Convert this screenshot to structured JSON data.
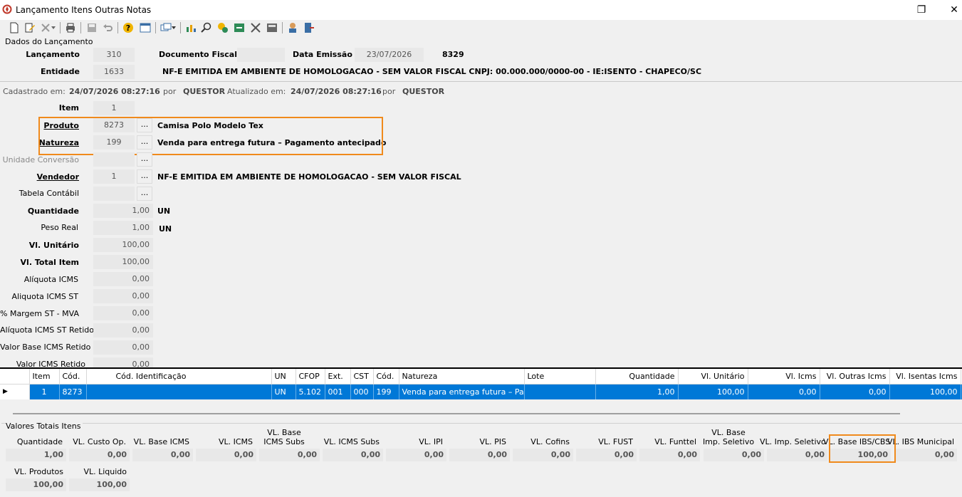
{
  "window": {
    "title": "Lançamento Itens Outras Notas",
    "restore_symbol": "❐",
    "close_symbol": "✕"
  },
  "group_title": "Dados do Lançamento",
  "header": {
    "lancamento_label": "Lançamento",
    "lancamento_value": "310",
    "documento_label": "Documento Fiscal",
    "documento_value": "",
    "data_emissao_label": "Data Emissão",
    "data_emissao_value": "23/07/2026",
    "number_value": "8329",
    "entidade_label": "Entidade",
    "entidade_value": "1633",
    "entidade_desc": "NF-E EMITIDA EM AMBIENTE DE HOMOLOGACAO - SEM VALOR FISCAL CNPJ: 00.000.000/0000-00 - IE:ISENTO - CHAPECO/SC"
  },
  "audit": {
    "cadastrado_label": "Cadastrado em:",
    "cadastrado_value": "24/07/2026 08:27:16",
    "por1": "por",
    "user1": "QUESTOR",
    "atualizado_label": "Atualizado em:",
    "atualizado_value": "24/07/2026 08:27:16",
    "por2": "por",
    "user2": "QUESTOR"
  },
  "form": {
    "item_label": "Item",
    "item_value": "1",
    "produto_label": "Produto",
    "produto_value": "8273",
    "produto_desc": "Camisa Polo Modelo Tex",
    "natureza_label": "Natureza",
    "natureza_value": "199",
    "natureza_desc": "Venda para entrega futura – Pagamento antecipado",
    "unidade_label": "Unidade Conversão",
    "vendedor_label": "Vendedor",
    "vendedor_value": "1",
    "vendedor_desc": "NF-E EMITIDA EM AMBIENTE DE HOMOLOGACAO - SEM VALOR FISCAL",
    "tabela_label": "Tabela Contábil",
    "dots": "...",
    "quantidade_label": "Quantidade",
    "quantidade_value": "1,00",
    "quantidade_unit": "UN",
    "peso_label": "Peso Real",
    "peso_value": "1,00",
    "peso_unit": "UN",
    "vl_unitario_label": "Vl. Unitário",
    "vl_unitario_value": "100,00",
    "vl_total_label": "Vl. Total Item",
    "vl_total_value": "100,00",
    "aliq_icms_label": "Alíquota ICMS",
    "aliq_icms_value": "0,00",
    "aliq_icms_st_label": "Aliquota ICMS ST",
    "aliq_icms_st_value": "0,00",
    "margem_label": "% Margem ST - MVA",
    "margem_value": "0,00",
    "aliq_st_retido_label": "Alíquota ICMS ST Retido",
    "aliq_st_retido_value": "0,00",
    "vl_base_retido_label": "Valor Base ICMS Retido",
    "vl_base_retido_value": "0,00",
    "vl_icms_retido_label": "Valor ICMS Retido",
    "vl_icms_retido_value": "0,00"
  },
  "grid": {
    "columns": [
      "Item",
      "Cód.",
      "Cód. Identificação",
      "Produto",
      "UN",
      "CFOP",
      "Ext.",
      "CST",
      "Cód.",
      "Natureza",
      "Lote",
      "Quantidade",
      "Vl. Unitário",
      "Vl. Icms",
      "Vl. Outras Icms",
      "Vl. Isentas Icms",
      "V"
    ],
    "row": [
      "1",
      "8273",
      "",
      "Camisa Polo Modelo Tex",
      "UN",
      "5.102",
      "001",
      "000",
      "199",
      "Venda para entrega futura – Pa...",
      "",
      "1,00",
      "100,00",
      "0,00",
      "0,00",
      "100,00",
      ""
    ],
    "row_indicator": "▶"
  },
  "totals": {
    "title": "Valores Totais Itens",
    "items": [
      {
        "label": "Quantidade",
        "value": "1,00"
      },
      {
        "label": "VL. Custo Op.",
        "value": "0,00"
      },
      {
        "label": "VL. Base ICMS",
        "value": "0,00"
      },
      {
        "label": "VL. ICMS",
        "value": "0,00"
      },
      {
        "label": "VL. Base\nICMS Subs",
        "value": "0,00"
      },
      {
        "label": "VL. ICMS Subs",
        "value": "0,00"
      },
      {
        "label": "VL. IPI",
        "value": "0,00"
      },
      {
        "label": "VL. PIS",
        "value": "0,00"
      },
      {
        "label": "VL. Cofins",
        "value": "0,00"
      },
      {
        "label": "VL. FUST",
        "value": "0,00"
      },
      {
        "label": "VL. Funttel",
        "value": "0,00"
      },
      {
        "label": "VL. Base\nImp. Seletivo",
        "value": "0,00"
      },
      {
        "label": "VL. Imp. Seletivo",
        "value": "0,00"
      },
      {
        "label": "VL. Base IBS/CBS",
        "value": "100,00"
      },
      {
        "label": "VL. IBS Municipal",
        "value": "0,00"
      }
    ],
    "produtos_label": "VL. Produtos",
    "produtos_value": "100,00",
    "liquido_label": "VL. Liquido",
    "liquido_value": "100,00"
  }
}
